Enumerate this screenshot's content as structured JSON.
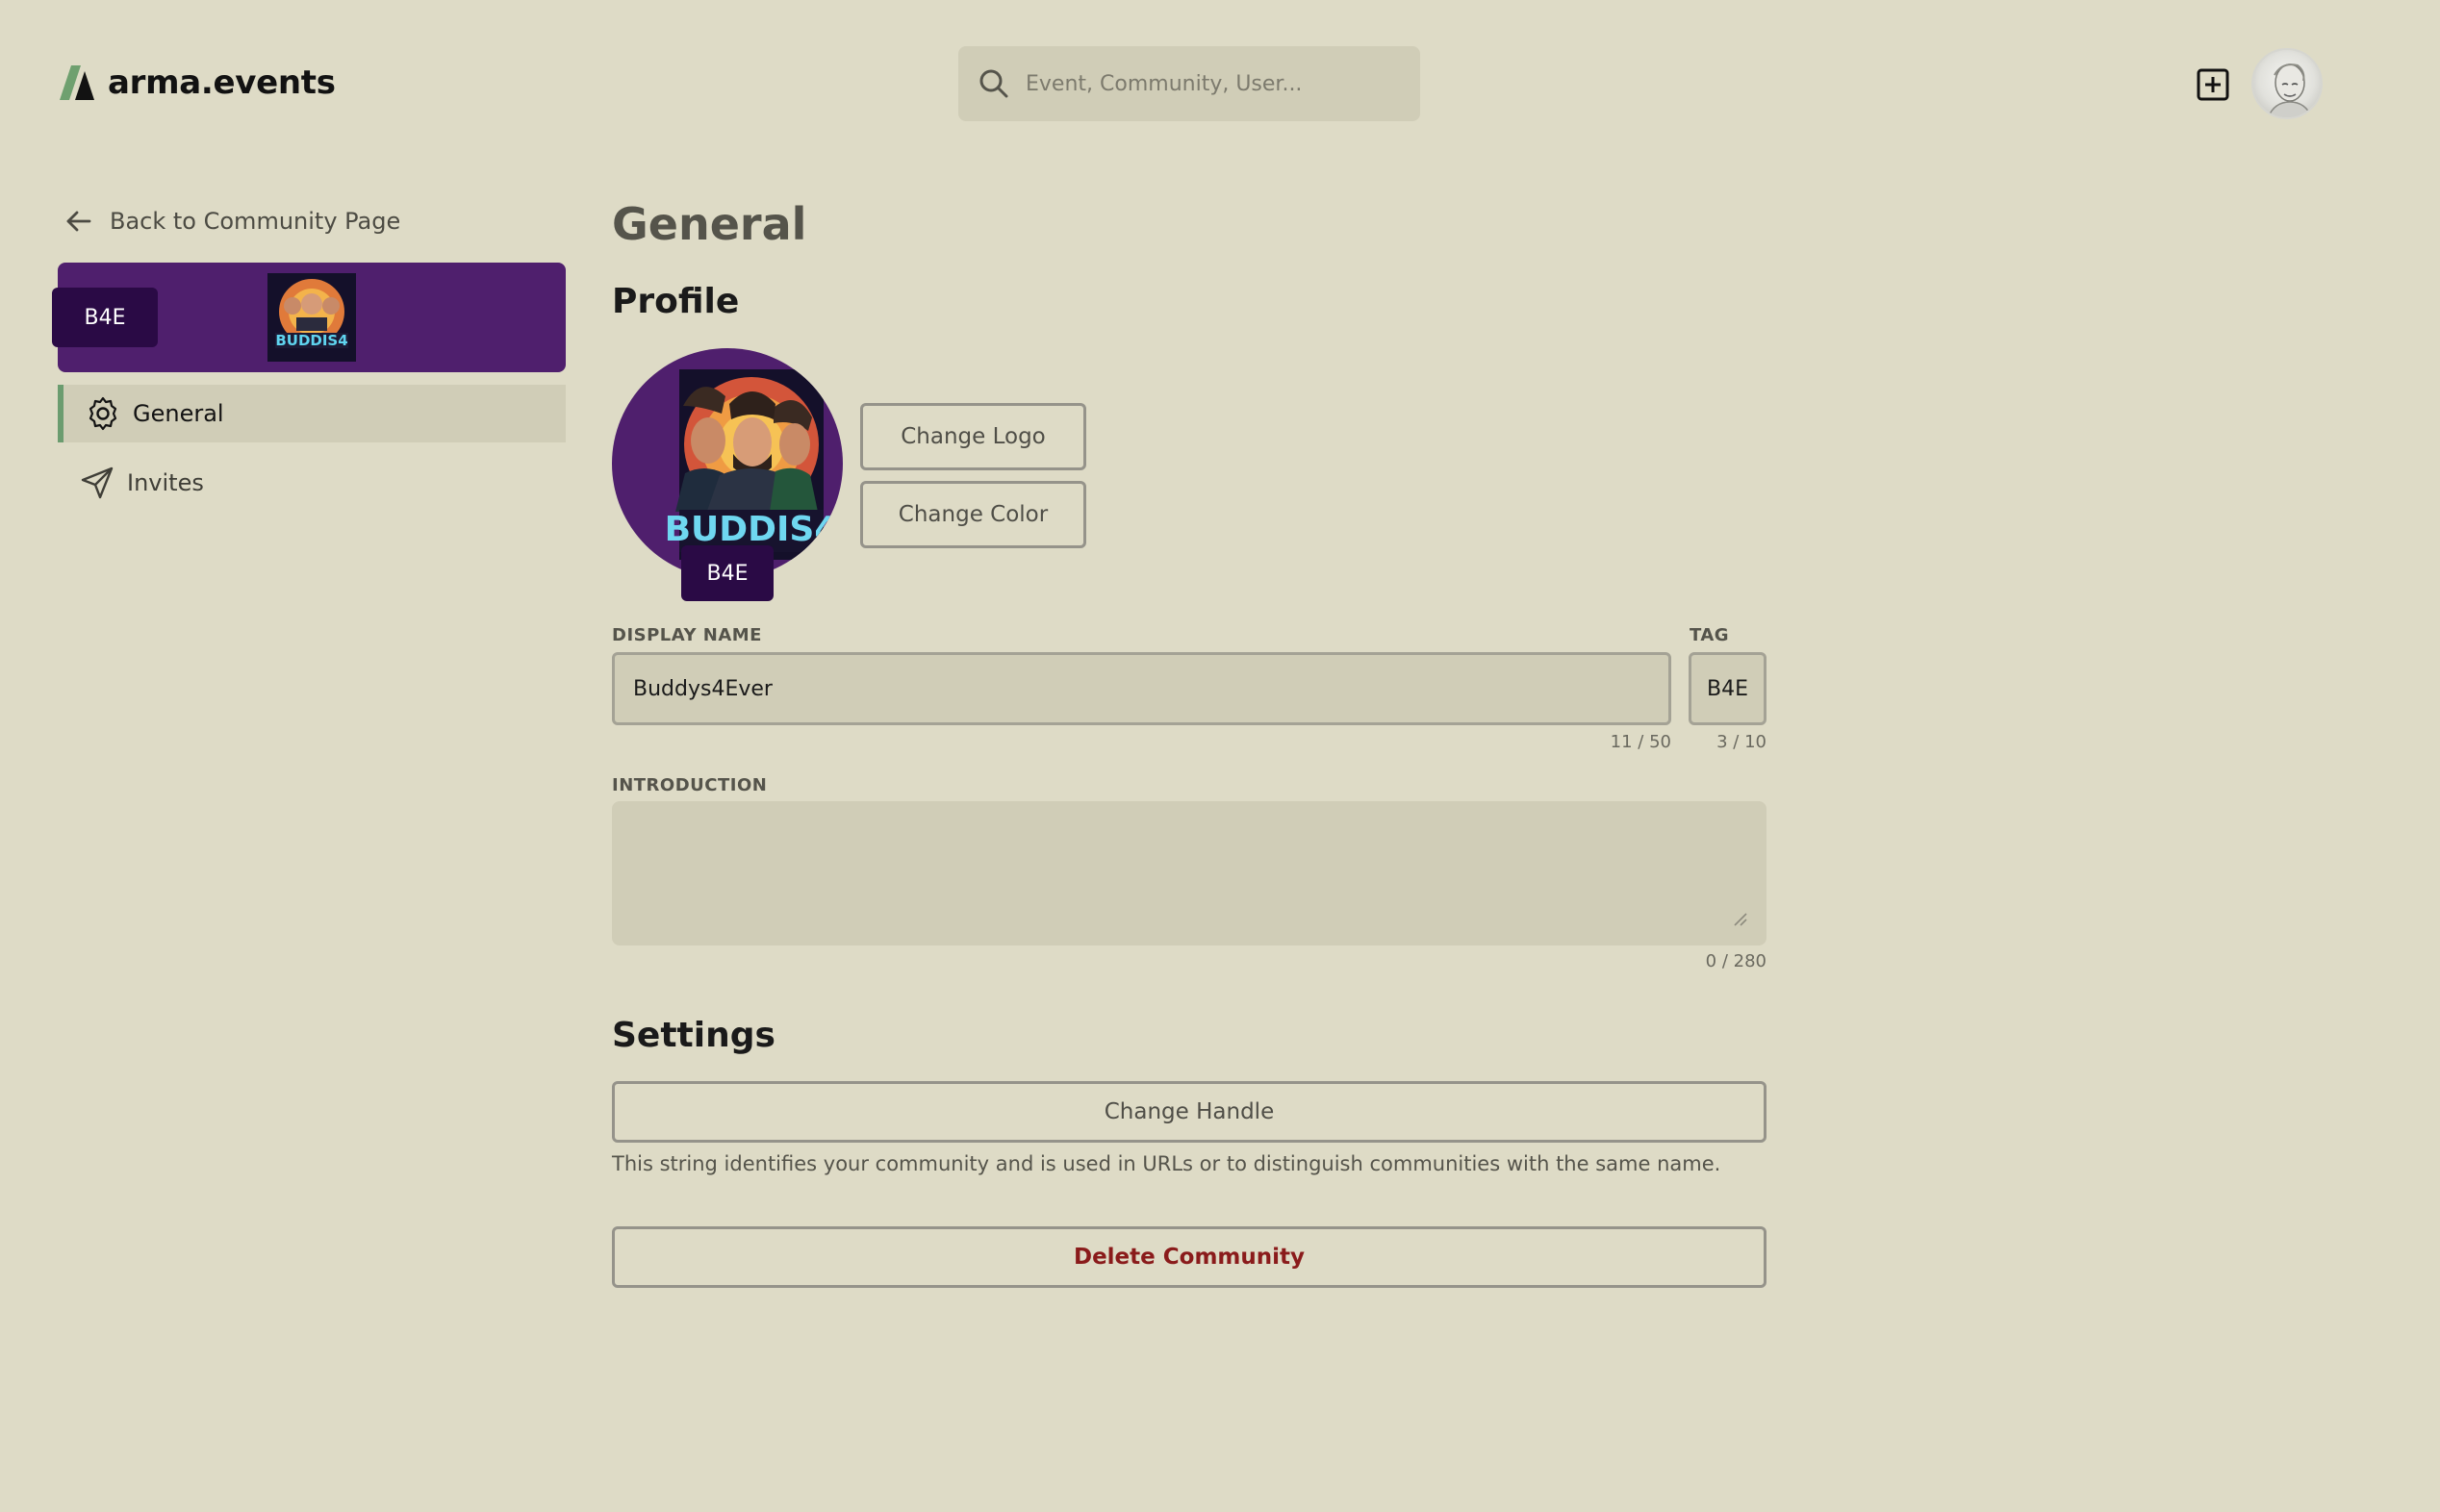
{
  "header": {
    "brand": "arma.events",
    "search_placeholder": "Event, Community, User..."
  },
  "sidebar": {
    "back_label": "Back to Community Page",
    "community_tag": "B4E",
    "community_color": "#4f1f6d",
    "items": [
      {
        "label": "General",
        "icon": "gear-icon",
        "active": true
      },
      {
        "label": "Invites",
        "icon": "send-icon",
        "active": false
      }
    ]
  },
  "main": {
    "page_title": "General",
    "profile": {
      "heading": "Profile",
      "tag_badge": "B4E",
      "change_logo_label": "Change Logo",
      "change_color_label": "Change Color"
    },
    "form": {
      "display_name_label": "DISPLAY NAME",
      "display_name_value": "Buddys4Ever",
      "display_name_counter": "11 / 50",
      "tag_label": "TAG",
      "tag_value": "B4E",
      "tag_counter": "3 / 10",
      "introduction_label": "INTRODUCTION",
      "introduction_value": "",
      "introduction_counter": "0 / 280"
    },
    "settings": {
      "heading": "Settings",
      "change_handle_label": "Change Handle",
      "handle_help": "This string identifies your community and is used in URLs or to distinguish communities with the same name.",
      "delete_label": "Delete Community"
    }
  },
  "colors": {
    "background": "#dedbc6",
    "input_bg": "#d0cdb7",
    "accent_green": "#6b9c6f",
    "tag_bg": "#2a0a45",
    "danger": "#8a1b1b"
  }
}
